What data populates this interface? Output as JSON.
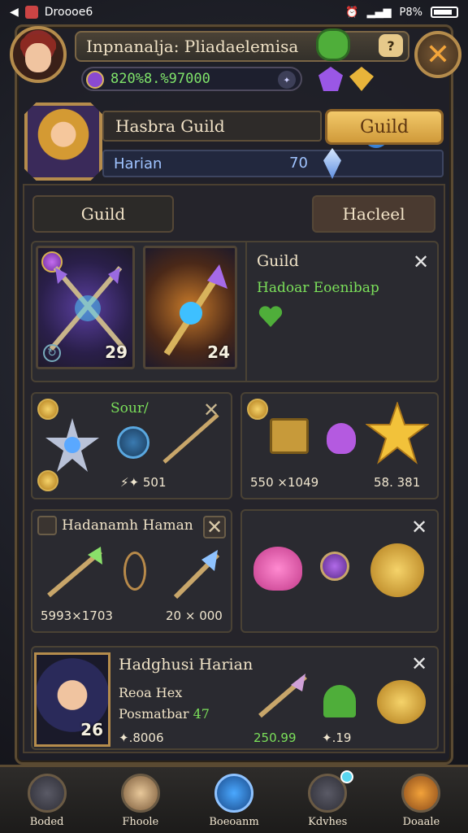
{
  "status_bar": {
    "app": "Droooe6",
    "carrier": "P8%"
  },
  "header": {
    "title": "Inpnanalja: Pliadaelemisa",
    "help_label": "?",
    "currency": "820%8.%97000"
  },
  "guild_header": {
    "name": "Hasbra Guild",
    "button": "Guild",
    "member": "Harian",
    "level": "70"
  },
  "tabs": {
    "left": "Guild",
    "right": "Hacleel"
  },
  "cards": {
    "featured": {
      "slot1_level": "29",
      "slot2_level": "24",
      "title": "Guild",
      "subtitle": "Hadoar Eoenibap"
    },
    "sour": {
      "title": "Sour/",
      "stat": "501"
    },
    "loot": {
      "stat1": "550",
      "stat1_mult": "×1049",
      "stat2": "58.",
      "stat2_mult": "381"
    },
    "hero1": {
      "title": "Hadanamh Haman",
      "stat1": "5993×1703",
      "stat2": "20",
      "stat2_mult": "000"
    },
    "hero2": {
      "title": "Hadghusi Harian",
      "line1": "Reoa Hex",
      "line2": "Posmatbar",
      "line2_num": "47",
      "level": "26",
      "stat1": ".8006",
      "stat2": "250.99",
      "stat3": ".19"
    }
  },
  "bottom_nav": [
    {
      "label": "Boded"
    },
    {
      "label": "Fhoole"
    },
    {
      "label": "Boeoanm"
    },
    {
      "label": "Kdvhes"
    },
    {
      "label": "Doaale"
    }
  ],
  "colors": {
    "accent_gold": "#e6b84f",
    "accent_green": "#7be05a",
    "accent_blue": "#4aa8ff"
  }
}
